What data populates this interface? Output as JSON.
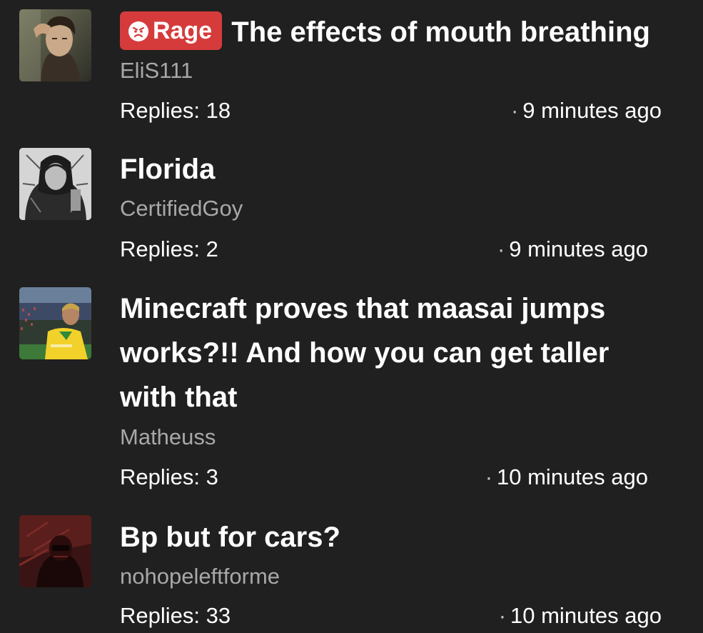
{
  "colors": {
    "background": "#202020",
    "title_text": "#ffffff",
    "author_text": "#a8a8a8",
    "rage_tag": "#d63b3c"
  },
  "threads": [
    {
      "tag": {
        "label": "Rage",
        "icon": "angry-face-icon"
      },
      "title": "The effects of mouth breathing",
      "author": "EliS111",
      "replies": "Replies: 18",
      "separator": "·",
      "time": "9 minutes ago"
    },
    {
      "title": "Florida",
      "author": "CertifiedGoy",
      "replies": "Replies: 2",
      "separator": "·",
      "time": "9 minutes ago"
    },
    {
      "title": "Minecraft proves that maasai jumps works?!! And how you can get taller with that",
      "author": "Matheuss",
      "replies": "Replies: 3",
      "separator": "·",
      "time": "10 minutes ago"
    },
    {
      "title": "Bp but for cars?",
      "author": "nohopeleftforme",
      "replies": "Replies: 33",
      "separator": "·",
      "time": "10 minutes ago"
    }
  ]
}
